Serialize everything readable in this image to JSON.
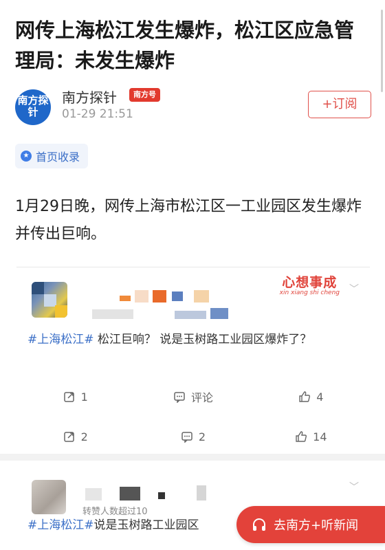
{
  "article": {
    "title": "网传上海松江发生爆炸，松江区应急管理局：未发生爆炸",
    "home_tag": "首页收录",
    "paragraph": "1月29日晚，网传上海市松江区一工业园区发生爆炸并传出巨响。"
  },
  "author": {
    "avatar_text": "南方探针",
    "name": "南方探针",
    "badge": "南方号",
    "time": "01-29 21:51",
    "subscribe_label": "+订阅"
  },
  "embedded_post_1": {
    "watermark_main": "心想事成",
    "watermark_sub": "xin xiang shi cheng",
    "hashtag": "#上海松江#",
    "text": " 松江巨响？ 说是玉树路工业园区爆炸了？",
    "actions_row1": {
      "repost": "1",
      "comment": "评论",
      "like": "4"
    },
    "actions_row2": {
      "repost": "2",
      "comment": "2",
      "like": "14"
    }
  },
  "embedded_post_2": {
    "meta": "转赞人数超过10",
    "hashtag": "#上海松江#",
    "text": "说是玉树路工业园区"
  },
  "cta": {
    "label": "去南方+听新闻"
  },
  "icons": {
    "repost": "share-icon",
    "comment": "comment-icon",
    "like": "thumbs-up-icon",
    "headphones": "headphones-icon",
    "star": "star-icon"
  },
  "colors": {
    "accent_red": "#e23a2e",
    "link_blue": "#3b6fc7",
    "muted_text": "#999999"
  }
}
